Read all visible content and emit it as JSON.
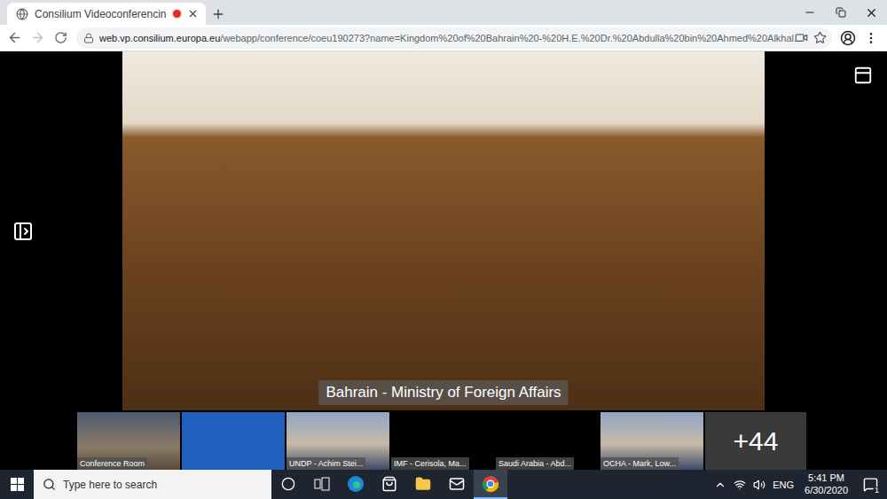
{
  "browser": {
    "tab": {
      "title": "Consilium Videoconferencin",
      "recording": true,
      "selected": true
    },
    "address": {
      "host": "web.vp.consilium.europa.eu",
      "path": "/webapp/conference/coeu190273?name=Kingdom%20of%20Bahrain%20-%20H.E.%20Dr.%20Abdulla%20bin%20Ahmed%20Alkhal..."
    }
  },
  "conference": {
    "main_label": "Bahrain - Ministry of Foreign Affairs",
    "participants": [
      {
        "kind": "room",
        "label": "Conference Room"
      },
      {
        "kind": "slide",
        "label": ""
      },
      {
        "kind": "video",
        "label": "UNDP - Achim Stei..."
      },
      {
        "kind": "off",
        "label": "IMF - Cerisola, Ma..."
      },
      {
        "kind": "off",
        "label": "Saudi Arabia - Abd..."
      },
      {
        "kind": "video",
        "label": "OCHA - Mark, Low..."
      }
    ],
    "more": "+44"
  },
  "taskbar": {
    "search_placeholder": "Type here to search",
    "apps": [
      {
        "kind": "cortana",
        "selected": false
      },
      {
        "kind": "taskview",
        "selected": false
      },
      {
        "kind": "edge",
        "selected": false
      },
      {
        "kind": "store",
        "selected": false
      },
      {
        "kind": "explorer",
        "selected": false
      },
      {
        "kind": "mail",
        "selected": false
      },
      {
        "kind": "chrome",
        "selected": true
      }
    ],
    "language": "ENG",
    "time": "5:41 PM",
    "date": "6/30/2020",
    "notifications": "1"
  }
}
